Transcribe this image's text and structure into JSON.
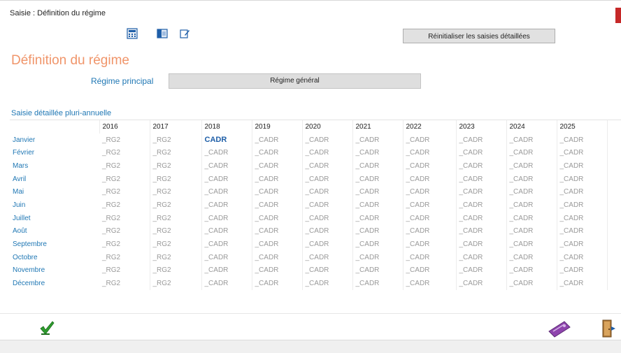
{
  "window": {
    "title": "Saisie : Définition du régime"
  },
  "toolbar": {
    "icons": [
      "calculator-icon",
      "window-icon",
      "edit-icon"
    ],
    "reset_label": "Réinitialiser les saisies détaillées"
  },
  "main": {
    "heading": "Définition du régime",
    "regime_label": "Régime principal",
    "regime_value": "Régime général",
    "section_label": "Saisie détaillée pluri-annuelle"
  },
  "grid": {
    "years": [
      "2016",
      "2017",
      "2018",
      "2019",
      "2020",
      "2021",
      "2022",
      "2023",
      "2024",
      "2025"
    ],
    "rows": [
      {
        "month": "Janvier",
        "cells": [
          "_RG2",
          "_RG2",
          "CADR",
          "_CADR",
          "_CADR",
          "_CADR",
          "_CADR",
          "_CADR",
          "_CADR",
          "_CADR"
        ]
      },
      {
        "month": "Février",
        "cells": [
          "_RG2",
          "_RG2",
          "_CADR",
          "_CADR",
          "_CADR",
          "_CADR",
          "_CADR",
          "_CADR",
          "_CADR",
          "_CADR"
        ]
      },
      {
        "month": "Mars",
        "cells": [
          "_RG2",
          "_RG2",
          "_CADR",
          "_CADR",
          "_CADR",
          "_CADR",
          "_CADR",
          "_CADR",
          "_CADR",
          "_CADR"
        ]
      },
      {
        "month": "Avril",
        "cells": [
          "_RG2",
          "_RG2",
          "_CADR",
          "_CADR",
          "_CADR",
          "_CADR",
          "_CADR",
          "_CADR",
          "_CADR",
          "_CADR"
        ]
      },
      {
        "month": "Mai",
        "cells": [
          "_RG2",
          "_RG2",
          "_CADR",
          "_CADR",
          "_CADR",
          "_CADR",
          "_CADR",
          "_CADR",
          "_CADR",
          "_CADR"
        ]
      },
      {
        "month": "Juin",
        "cells": [
          "_RG2",
          "_RG2",
          "_CADR",
          "_CADR",
          "_CADR",
          "_CADR",
          "_CADR",
          "_CADR",
          "_CADR",
          "_CADR"
        ]
      },
      {
        "month": "Juillet",
        "cells": [
          "_RG2",
          "_RG2",
          "_CADR",
          "_CADR",
          "_CADR",
          "_CADR",
          "_CADR",
          "_CADR",
          "_CADR",
          "_CADR"
        ]
      },
      {
        "month": "Août",
        "cells": [
          "_RG2",
          "_RG2",
          "_CADR",
          "_CADR",
          "_CADR",
          "_CADR",
          "_CADR",
          "_CADR",
          "_CADR",
          "_CADR"
        ]
      },
      {
        "month": "Septembre",
        "cells": [
          "_RG2",
          "_RG2",
          "_CADR",
          "_CADR",
          "_CADR",
          "_CADR",
          "_CADR",
          "_CADR",
          "_CADR",
          "_CADR"
        ]
      },
      {
        "month": "Octobre",
        "cells": [
          "_RG2",
          "_RG2",
          "_CADR",
          "_CADR",
          "_CADR",
          "_CADR",
          "_CADR",
          "_CADR",
          "_CADR",
          "_CADR"
        ]
      },
      {
        "month": "Novembre",
        "cells": [
          "_RG2",
          "_RG2",
          "_CADR",
          "_CADR",
          "_CADR",
          "_CADR",
          "_CADR",
          "_CADR",
          "_CADR",
          "_CADR"
        ]
      },
      {
        "month": "Décembre",
        "cells": [
          "_RG2",
          "_RG2",
          "_CADR",
          "_CADR",
          "_CADR",
          "_CADR",
          "_CADR",
          "_CADR",
          "_CADR",
          "_CADR"
        ]
      }
    ]
  },
  "footer": {
    "icons": [
      "checkmark-icon",
      "ticket-icon",
      "exit-door-icon"
    ]
  },
  "colors": {
    "accent": "#1f77b4",
    "heading": "#f0956a",
    "close": "#c62828",
    "ok": "#2e9d2e",
    "ticket": "#8e44ad"
  }
}
